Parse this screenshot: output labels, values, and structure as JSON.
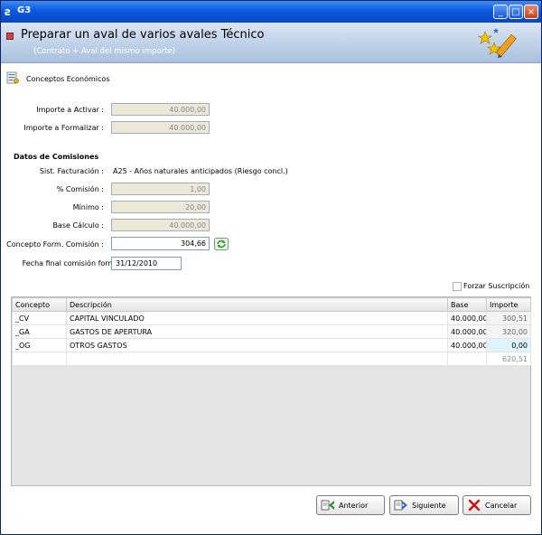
{
  "window": {
    "title": "G3",
    "minimize": "_",
    "maximize": "□",
    "close": "×"
  },
  "header": {
    "title": "Preparar un aval de varios avales Técnico",
    "subtitle": "(Contrato + Aval del mismo importe)"
  },
  "economicos": {
    "section_title": "Conceptos Económicos",
    "importe_activar_label": "Importe a Activar :",
    "importe_activar_value": "40.000,00",
    "importe_formalizar_label": "Importe a Formalizar :",
    "importe_formalizar_value": "40.000,00"
  },
  "comisiones": {
    "section_title": "Datos de Comisiones",
    "sist_facturacion_label": "Sist. Facturación :",
    "sist_facturacion_value": "A25 - Años naturales anticipados (Riesgo concl.)",
    "pct_comision_label": "% Comisión :",
    "pct_comision_value": "1,00",
    "minimo_label": "Mínimo :",
    "minimo_value": "20,00",
    "base_calculo_label": "Base Cálculo :",
    "base_calculo_value": "40.000,00",
    "concepto_form_label": "Concepto Form. Comisión :",
    "concepto_form_value": "304,66",
    "fecha_final_label": "Fecha final comisión form. :",
    "fecha_final_value": "31/12/2010",
    "forzar_label": "Forzar Suscripción"
  },
  "grid": {
    "columns": [
      "Concepto",
      "Descripción",
      "Base",
      "Importe"
    ],
    "rows": [
      {
        "concepto": "_CV",
        "descripcion": "CAPITAL VINCULADO",
        "base": "40.000,00",
        "importe": "300,51"
      },
      {
        "concepto": "_GA",
        "descripcion": "GASTOS DE APERTURA",
        "base": "40.000,00",
        "importe": "320,00"
      },
      {
        "concepto": "_OG",
        "descripcion": "OTROS GASTOS",
        "base": "40.000,00",
        "importe": "0,00"
      }
    ],
    "total": "620,51"
  },
  "buttons": {
    "anterior": "Anterior",
    "siguiente": "Siguiente",
    "cancelar": "Cancelar"
  },
  "colors": {
    "titlebar": "#0a5ae0",
    "banner": "#a9c0de",
    "readonly_field": "#ece9d8"
  }
}
